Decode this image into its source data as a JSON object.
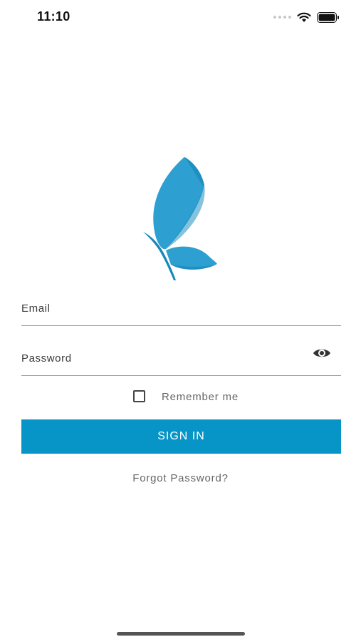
{
  "status_bar": {
    "time": "11:10",
    "icons": [
      "signal-icon",
      "wifi-icon",
      "battery-icon"
    ]
  },
  "logo": {
    "icon": "butterfly-logo-icon",
    "color": "#2a9fd1"
  },
  "form": {
    "email_label": "Email",
    "password_label": "Password",
    "remember_label": "Remember me",
    "remember_checked": false,
    "signin_label": "SIGN IN",
    "forgot_label": "Forgot Password?"
  },
  "colors": {
    "accent": "#0795c8",
    "divider": "#9e9e9e",
    "text_muted": "#666666"
  }
}
